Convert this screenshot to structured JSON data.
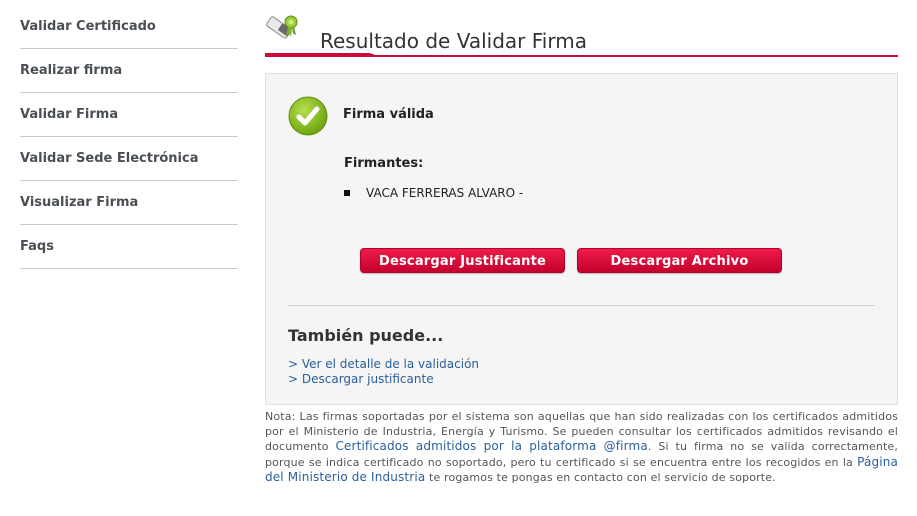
{
  "sidebar": {
    "items": [
      {
        "label": "Validar Certificado"
      },
      {
        "label": "Realizar firma"
      },
      {
        "label": "Validar Firma"
      },
      {
        "label": "Validar Sede Electrónica"
      },
      {
        "label": "Visualizar Firma"
      },
      {
        "label": "Faqs"
      }
    ]
  },
  "header": {
    "title": "Resultado de Validar Firma",
    "icon": "certificate-seal-icon",
    "accent_color": "#cc0a3a"
  },
  "result": {
    "status_icon": "check-circle-icon",
    "status": "Firma válida",
    "firmantes_label": "Firmantes:",
    "signers": [
      "VACA FERRERAS ALVARO -"
    ]
  },
  "actions": {
    "download_justificante": "Descargar Justificante",
    "download_archivo": "Descargar Archivo"
  },
  "also": {
    "title": "También puede...",
    "links": [
      "> Ver el detalle de la validación",
      "> Descargar justificante"
    ]
  },
  "note": {
    "text_1": "Nota: Las firmas soportadas por el sistema son aquellas que han sido realizadas con los certificados admitidos por el Ministerio de Industria, Energía y Turismo. Se pueden consultar los certificados admitidos revisando el documento ",
    "link_1": "Certificados admitidos por la plataforma @firma",
    "text_2": ". Si tu firma no se valida correctamente, porque se indica certificado no soportado, pero tu certificado si se encuentra entre los recogidos en la ",
    "link_2": "Página del Ministerio de Industria",
    "text_3": " te rogamos te pongas en contacto con el servicio de soporte."
  }
}
